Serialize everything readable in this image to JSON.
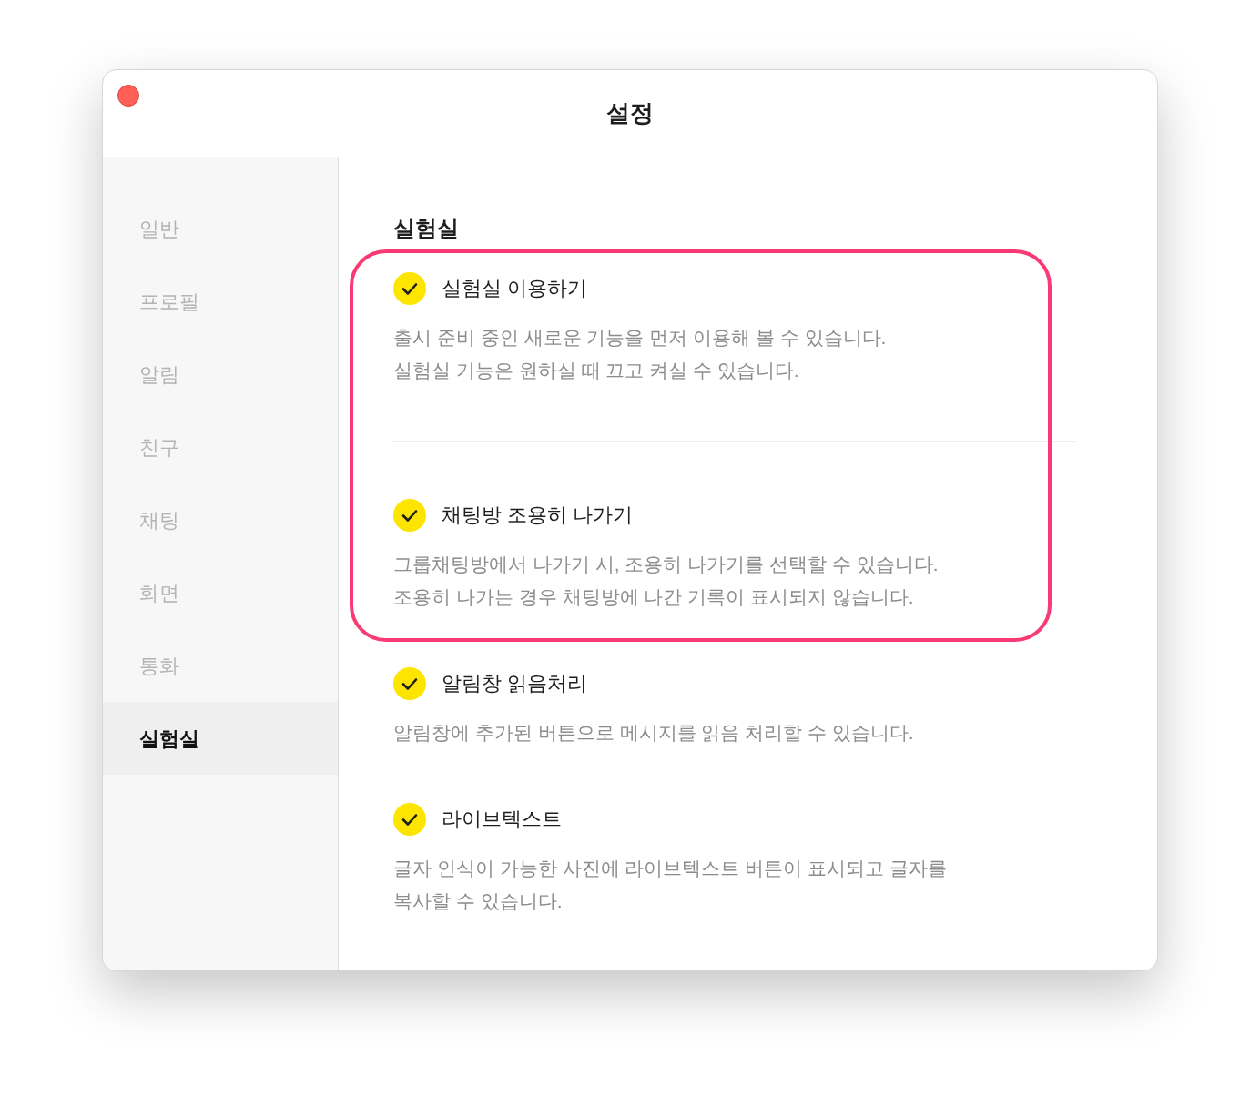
{
  "window": {
    "title": "설정"
  },
  "sidebar": {
    "items": [
      {
        "label": "일반",
        "selected": false
      },
      {
        "label": "프로필",
        "selected": false
      },
      {
        "label": "알림",
        "selected": false
      },
      {
        "label": "친구",
        "selected": false
      },
      {
        "label": "채팅",
        "selected": false
      },
      {
        "label": "화면",
        "selected": false
      },
      {
        "label": "통화",
        "selected": false
      },
      {
        "label": "실험실",
        "selected": true
      }
    ]
  },
  "content": {
    "heading": "실험실",
    "features": [
      {
        "kind": "main",
        "title": "실험실 이용하기",
        "checked": true,
        "highlighted": true,
        "description": [
          "출시 준비 중인 새로운 기능을 먼저 이용해 볼 수 있습니다.",
          "실험실 기능은 원하실 때 끄고 켜실 수 있습니다."
        ]
      },
      {
        "kind": "feature",
        "title": "채팅방 조용히 나가기",
        "checked": true,
        "highlighted": true,
        "description": [
          "그룹채팅방에서 나가기 시, 조용히 나가기를 선택할 수 있습니다.",
          "조용히 나가는 경우 채팅방에 나간 기록이 표시되지 않습니다."
        ]
      },
      {
        "kind": "feature",
        "title": "알림창 읽음처리",
        "checked": true,
        "highlighted": false,
        "description": [
          "알림창에 추가된 버튼으로 메시지를 읽음 처리할 수 있습니다."
        ]
      },
      {
        "kind": "feature",
        "title": "라이브텍스트",
        "checked": true,
        "highlighted": false,
        "description": [
          "글자 인식이 가능한 사진에 라이브텍스트 버튼이 표시되고 글자를",
          "복사할 수 있습니다."
        ]
      }
    ]
  }
}
